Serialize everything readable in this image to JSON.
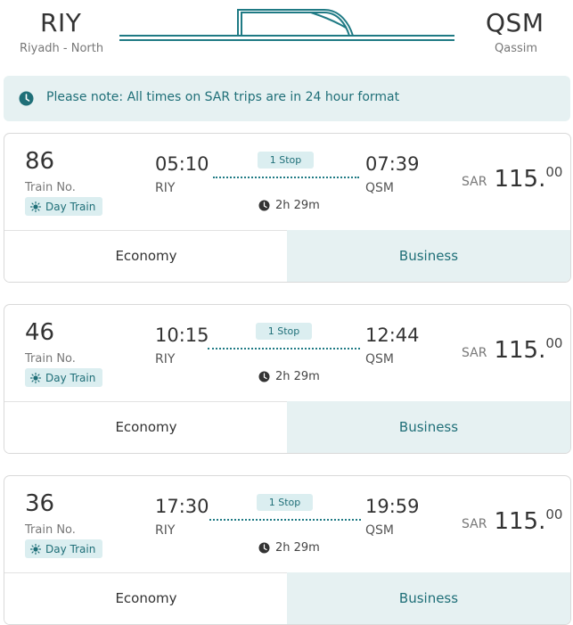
{
  "header": {
    "origin_code": "RIY",
    "origin_name": "Riyadh - North",
    "destination_code": "QSM",
    "destination_name": "Qassim"
  },
  "note": {
    "text": "Please note: All times on SAR trips are in 24 hour format",
    "icon": "clock-icon"
  },
  "colors": {
    "accent": "#1f7a84",
    "note_bg": "#e6f1f2",
    "badge_bg": "#dbeef0"
  },
  "trips": [
    {
      "train_no": "86",
      "train_label": "Train No.",
      "badge": "Day Train",
      "depart_time": "05:10",
      "depart_code": "RIY",
      "arrive_time": "07:39",
      "arrive_code": "QSM",
      "stops": "1 Stop",
      "duration": "2h 29m",
      "currency": "SAR",
      "price_whole": "115.",
      "price_dec": "00",
      "economy": "Economy",
      "business": "Business"
    },
    {
      "train_no": "46",
      "train_label": "Train No.",
      "badge": "Day Train",
      "depart_time": "10:15",
      "depart_code": "RIY",
      "arrive_time": "12:44",
      "arrive_code": "QSM",
      "stops": "1 Stop",
      "duration": "2h 29m",
      "currency": "SAR",
      "price_whole": "115.",
      "price_dec": "00",
      "economy": "Economy",
      "business": "Business"
    },
    {
      "train_no": "36",
      "train_label": "Train No.",
      "badge": "Day Train",
      "depart_time": "17:30",
      "depart_code": "RIY",
      "arrive_time": "19:59",
      "arrive_code": "QSM",
      "stops": "1 Stop",
      "duration": "2h 29m",
      "currency": "SAR",
      "price_whole": "115.",
      "price_dec": "00",
      "economy": "Economy",
      "business": "Business"
    }
  ]
}
